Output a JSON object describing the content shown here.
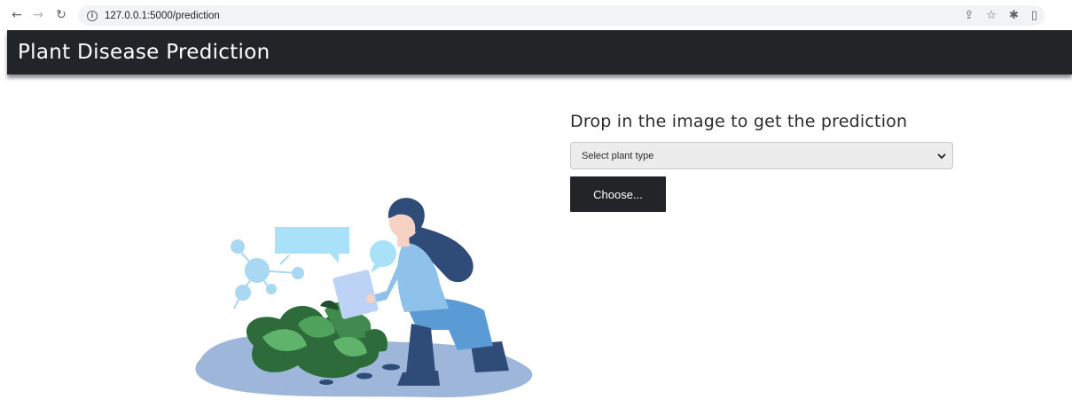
{
  "browser": {
    "back_icon": "arrow-left-icon",
    "forward_icon": "arrow-right-icon",
    "reload_icon": "reload-icon",
    "url": "127.0.0.1:5000/prediction",
    "info_icon": "info-icon",
    "share_icon": "share-icon",
    "bookmark_icon": "star-icon",
    "extensions_icon": "puzzle-icon",
    "sidepanel_icon": "side-panel-icon"
  },
  "header": {
    "title": "Plant Disease Prediction",
    "background": "#232427"
  },
  "main": {
    "heading": "Drop in the image to get the prediction",
    "plant_select": {
      "selected": "Select plant type"
    },
    "choose_button": "Choose..."
  },
  "colors": {
    "dark": "#232427",
    "accent_blue": "#5b9bd5",
    "leaf_green": "#2e6b3a"
  }
}
